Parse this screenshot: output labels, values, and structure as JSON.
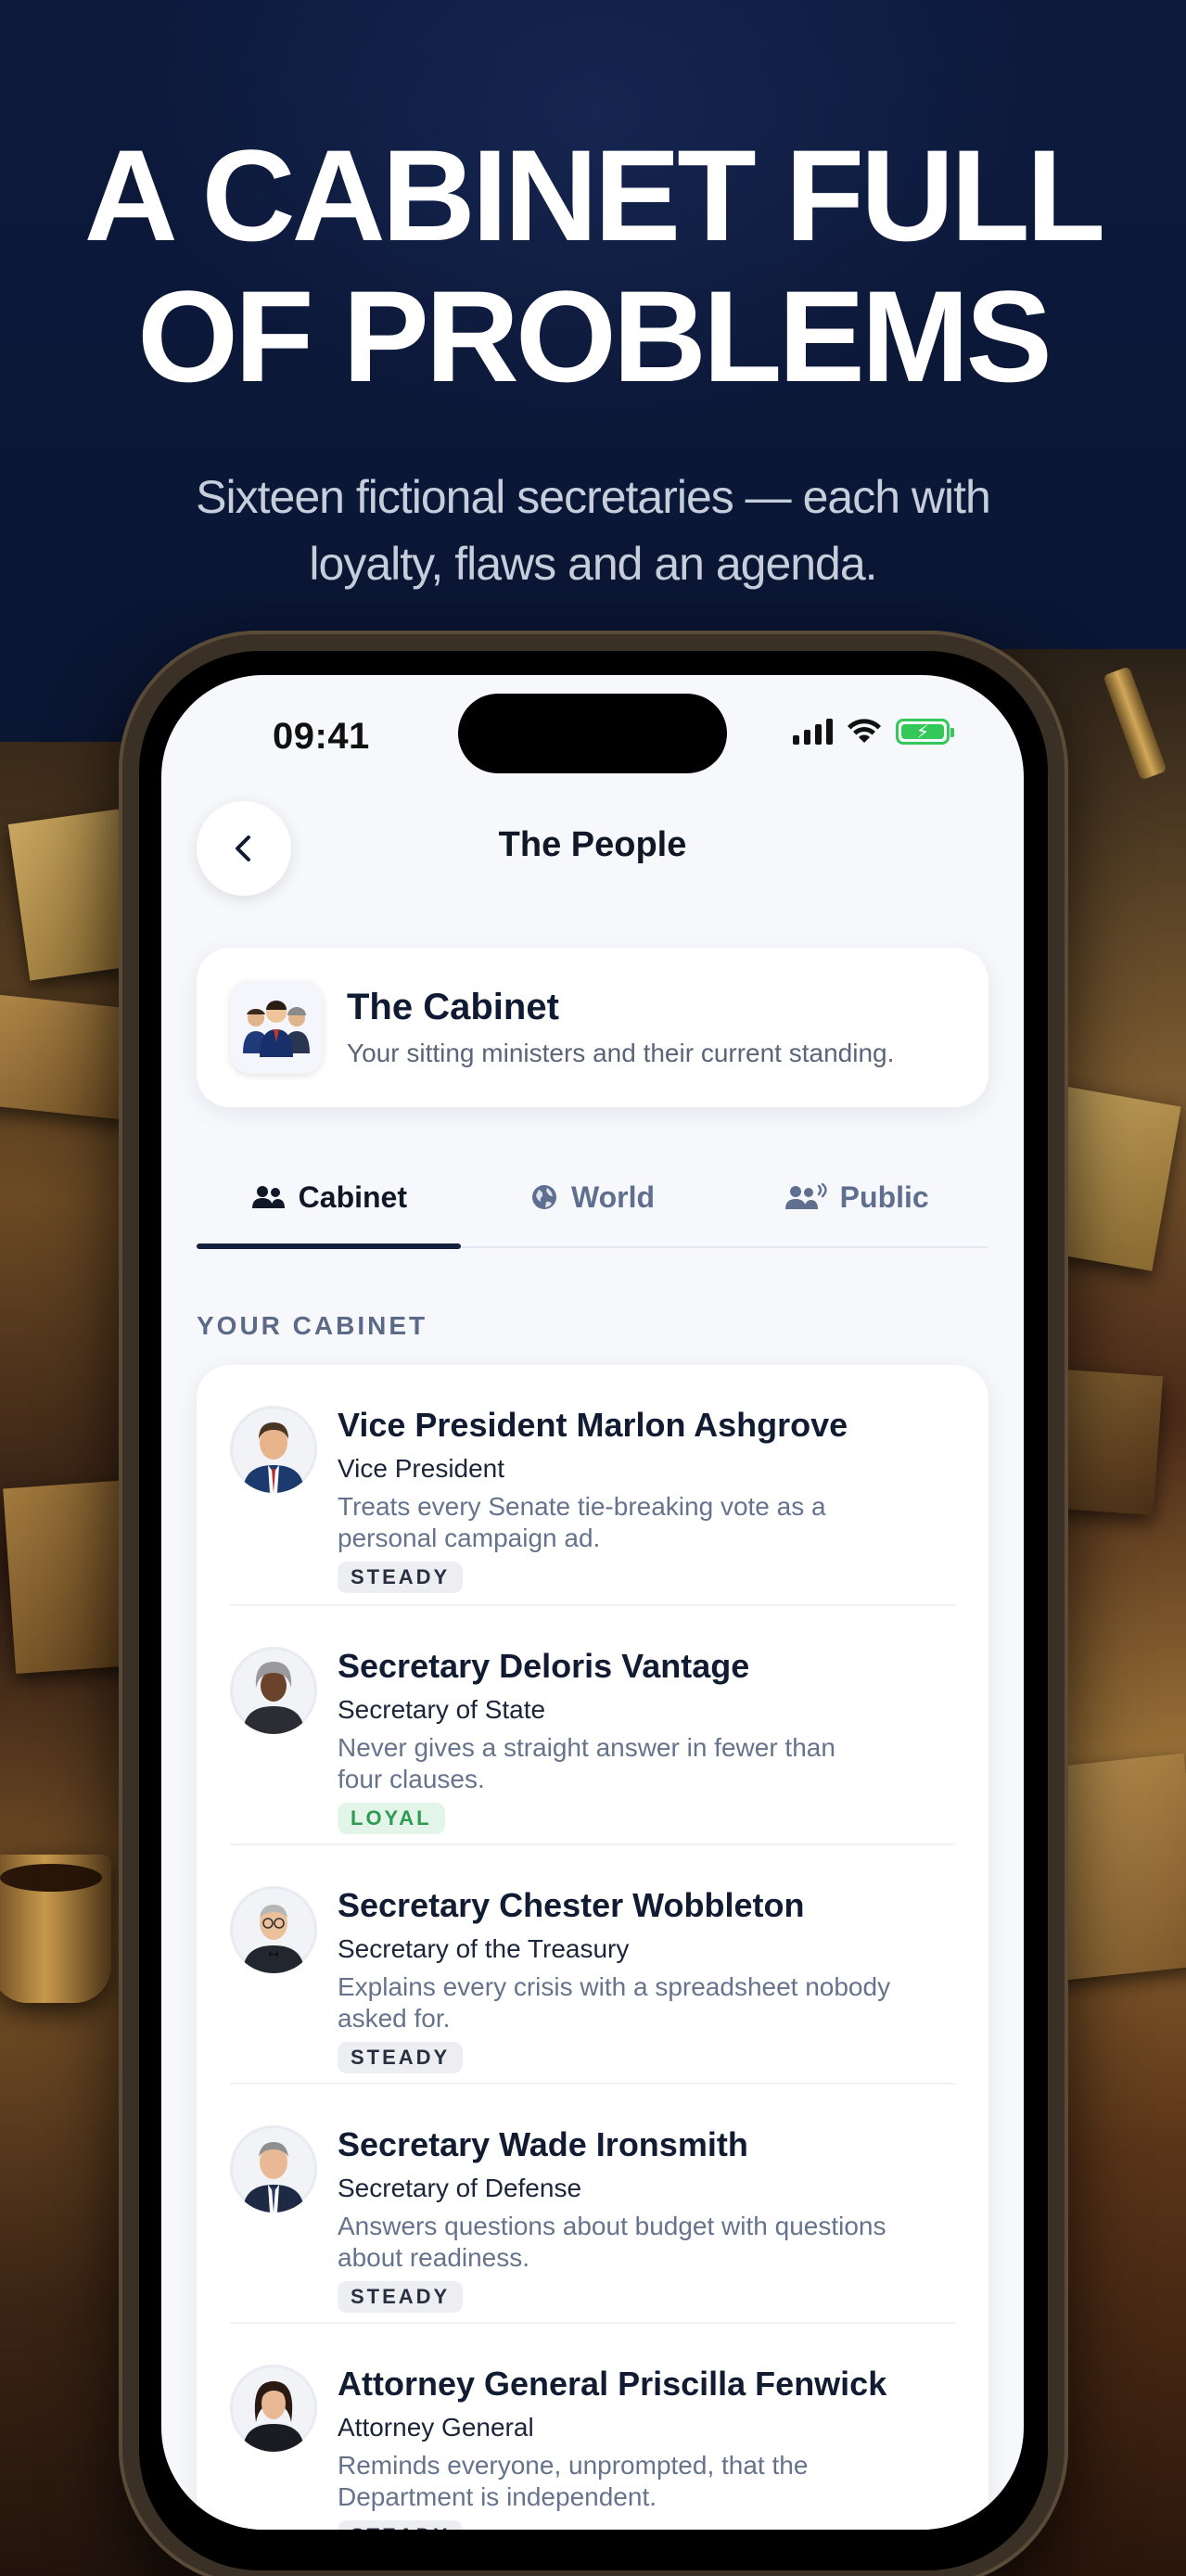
{
  "headline": {
    "line1": "A CABINET FULL",
    "line2": "OF PROBLEMS",
    "sub_line1": "Sixteen fictional secretaries — each with",
    "sub_line2": "loyalty, flaws and an agenda."
  },
  "status_bar": {
    "time": "09:41"
  },
  "nav": {
    "title": "The People"
  },
  "header_card": {
    "title": "The Cabinet",
    "subtitle": "Your sitting ministers and their current standing."
  },
  "tabs": [
    {
      "label": "Cabinet",
      "icon": "people-icon",
      "active": true
    },
    {
      "label": "World",
      "icon": "globe-icon",
      "active": false
    },
    {
      "label": "Public",
      "icon": "crowd-voice-icon",
      "active": false
    }
  ],
  "section_label": "YOUR CABINET",
  "members": [
    {
      "name": "Vice President Marlon Ashgrove",
      "title": "Vice President",
      "desc_line1": "Treats every Senate tie-breaking vote as a",
      "desc_line2": "personal campaign ad.",
      "status": "STEADY"
    },
    {
      "name": "Secretary Deloris Vantage",
      "title": "Secretary of State",
      "desc_line1": "Never gives a straight answer in fewer than",
      "desc_line2": "four clauses.",
      "status": "LOYAL"
    },
    {
      "name": "Secretary Chester Wobbleton",
      "title": "Secretary of the Treasury",
      "desc_line1": "Explains every crisis with a spreadsheet nobody",
      "desc_line2": "asked for.",
      "status": "STEADY"
    },
    {
      "name": "Secretary Wade Ironsmith",
      "title": "Secretary of Defense",
      "desc_line1": "Answers questions about budget with questions",
      "desc_line2": "about readiness.",
      "status": "STEADY"
    },
    {
      "name": "Attorney General Priscilla Fenwick",
      "title": "Attorney General",
      "desc_line1": "Reminds everyone, unprompted, that the",
      "desc_line2": "Department is independent.",
      "status": "STEADY"
    }
  ],
  "colors": {
    "accent": "#14213d",
    "loyal": "#2f9a52",
    "battery": "#34c759",
    "background": "#0b1634"
  }
}
